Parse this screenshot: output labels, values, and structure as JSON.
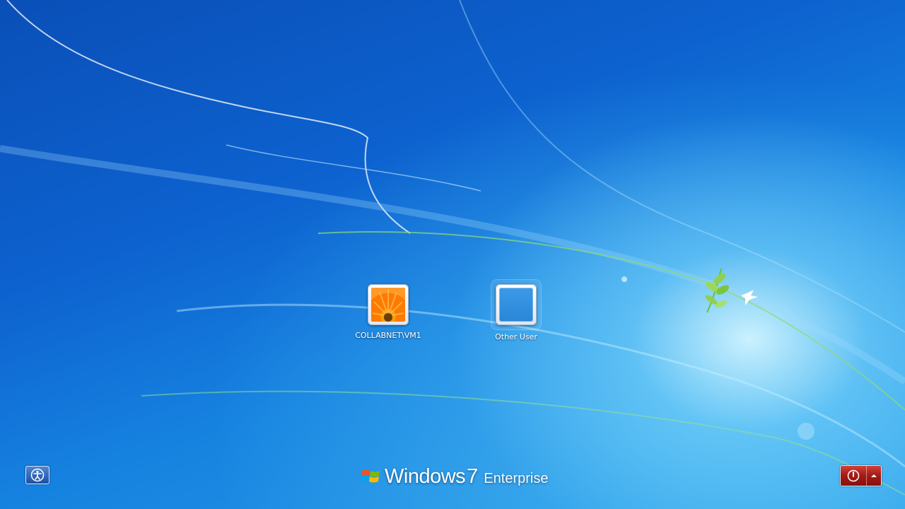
{
  "users": [
    {
      "name": "COLLABNET\\VM1",
      "picture": "orange-flower"
    },
    {
      "name": "Other User",
      "picture": "blank"
    }
  ],
  "branding": {
    "name": "Windows",
    "version": "7",
    "edition": "Enterprise"
  },
  "controls": {
    "ease_of_access_icon": "ease-of-access-icon",
    "shutdown_icon": "power-icon",
    "shutdown_options_icon": "chevron-up-icon"
  },
  "colors": {
    "background": "#0d62cf",
    "shutdown": "#b3221c"
  }
}
